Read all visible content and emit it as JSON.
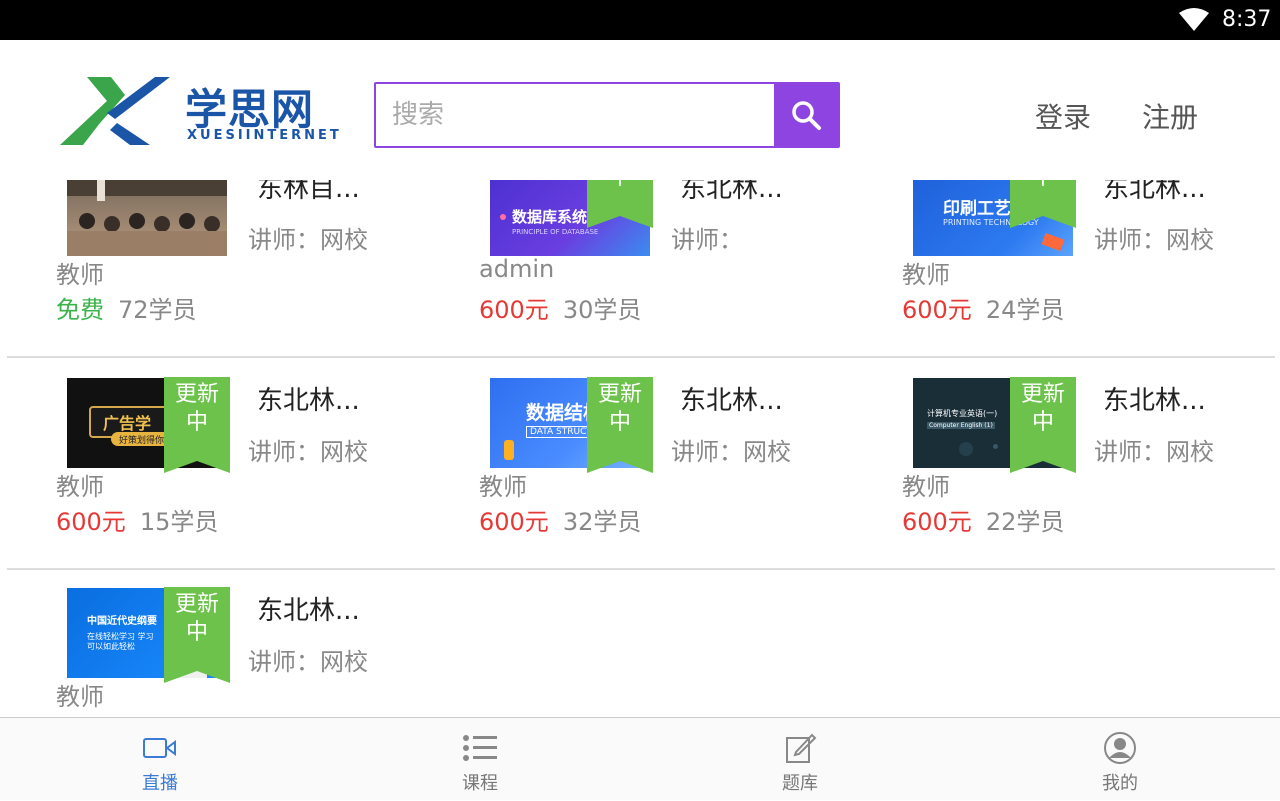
{
  "status": {
    "time": "8:37"
  },
  "header": {
    "logo_cn": "学思网",
    "logo_en": "XUESIINTERNET",
    "search_placeholder": "搜索",
    "login": "登录",
    "register": "注册"
  },
  "badge_text": "更新中",
  "courses": [
    {
      "title": "东林目...",
      "teacher": "讲师：网校",
      "teacher_cont": "教师",
      "price": "免费",
      "students": "72学员",
      "badge": false,
      "thumb": "classroom"
    },
    {
      "title": "东北林...",
      "teacher": "讲师：",
      "teacher_cont": "admin",
      "price": "600元",
      "students": "30学员",
      "badge": true,
      "thumb_text": "数据库系统",
      "thumb_sub": "PRINCIPLE OF DATABASE"
    },
    {
      "title": "东北林...",
      "teacher": "讲师：网校",
      "teacher_cont": "教师",
      "price": "600元",
      "students": "24学员",
      "badge": true,
      "thumb_text": "印刷工艺",
      "thumb_sub": "PRINTING TECHNOLOGY"
    },
    {
      "title": "东北林...",
      "teacher": "讲师：网校",
      "teacher_cont": "教师",
      "price": "600元",
      "students": "15学员",
      "badge": true,
      "thumb_text": "广告学",
      "thumb_sub": "好策划得你的"
    },
    {
      "title": "东北林...",
      "teacher": "讲师：网校",
      "teacher_cont": "教师",
      "price": "600元",
      "students": "32学员",
      "badge": true,
      "thumb_text": "数据结构",
      "thumb_sub": "DATA STRUCTURE"
    },
    {
      "title": "东北林...",
      "teacher": "讲师：网校",
      "teacher_cont": "教师",
      "price": "600元",
      "students": "22学员",
      "badge": true,
      "thumb_text": "计算机专业英语(一)",
      "thumb_sub": "Computer English (1)"
    },
    {
      "title": "东北林...",
      "teacher": "讲师：网校",
      "teacher_cont": "教师",
      "price": "",
      "students": "",
      "badge": true,
      "thumb_text": "中国近代史纲要",
      "thumb_sub": "在线轻松学习 学习可以如此轻松"
    }
  ],
  "tabs": [
    {
      "label": "直播",
      "icon": "video-icon",
      "active": true
    },
    {
      "label": "课程",
      "icon": "list-icon",
      "active": false
    },
    {
      "label": "题库",
      "icon": "edit-icon",
      "active": false
    },
    {
      "label": "我的",
      "icon": "user-icon",
      "active": false
    }
  ],
  "colors": {
    "accent": "#8e44e0",
    "ribbon": "#6cc24a",
    "price": "#e53935",
    "free": "#3cb34a",
    "tab_active": "#3a7bd5"
  }
}
